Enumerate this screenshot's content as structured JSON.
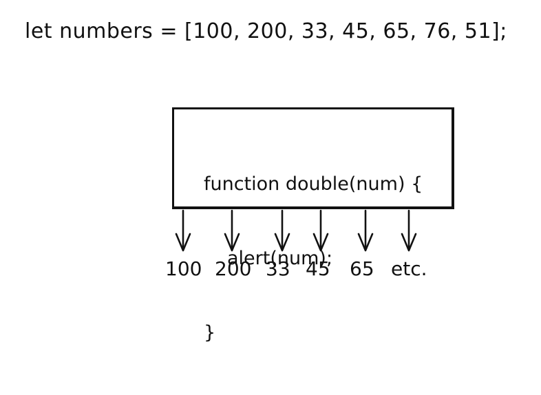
{
  "array_declaration": "let numbers = [100, 200, 33, 45, 65, 76, 51];",
  "function_box": {
    "line1": "function double(num) {",
    "line2": "alert(num);",
    "line3": "}"
  },
  "outputs": [
    "100",
    "200",
    "33",
    "45",
    "65",
    "etc."
  ]
}
